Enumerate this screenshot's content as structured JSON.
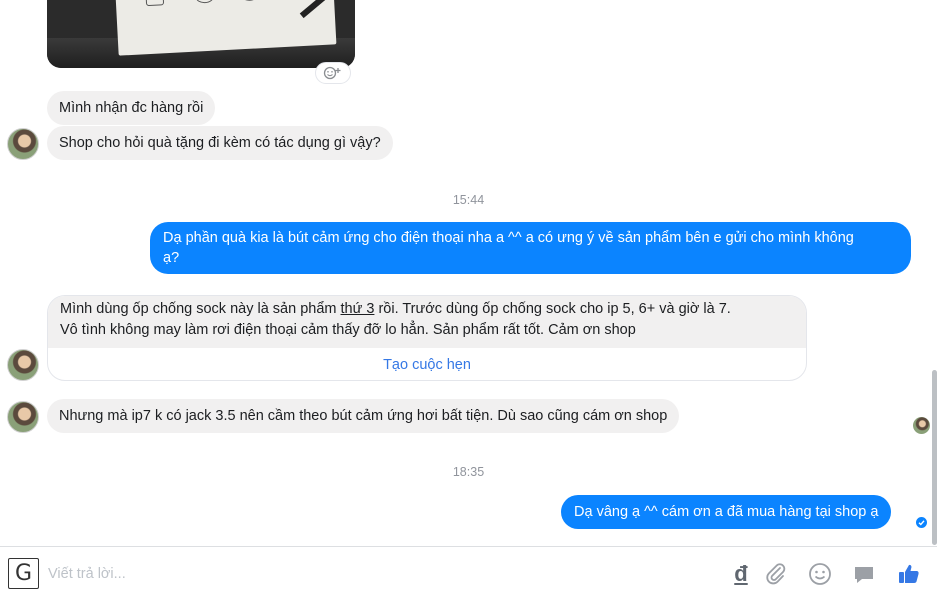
{
  "messages": {
    "m1": "Mình nhận đc hàng rồi",
    "m2": "Shop cho hỏi quà tặng đi kèm có tác dụng gì vậy?",
    "time1": "15:44",
    "m3_line1": "Dạ phần quà kia là bút cảm ứng cho điện thoại nha a ^^ a có ưng ý về sản phẩm bên e gửi cho mình không",
    "m3_line2": "ạ?",
    "m4_part1": "Mình dùng ốp chống sock này là sản phẩm ",
    "m4_link": "thứ 3",
    "m4_part2": " rồi. Trước dùng ốp chống sock cho ip 5, 6+ và giờ là 7.",
    "m4_line2": "Vô tình không may làm rơi điện thoại cảm thấy đỡ lo hẳn. Sản phẩm rất tốt. Cảm ơn shop",
    "m4_action": "Tạo cuộc hẹn",
    "m5": "Nhưng mà ip7 k có jack 3.5 nên cầm theo bút cảm ứng hơi bất tiện. Dù sao cũng cám ơn shop",
    "time2": "18:35",
    "m6": "Dạ vâng ạ ^^ cám ơn a đã mua hàng tại shop ạ"
  },
  "composer": {
    "placeholder": "Viết trả lời...",
    "currency_symbol": "đ"
  },
  "icons": {
    "add_reaction": "smiley-plus-icon",
    "currency": "dong-icon",
    "attach": "paperclip-icon",
    "emoji": "smiley-icon",
    "sticker": "chat-bubble-icon",
    "like": "thumbs-up-icon"
  },
  "colors": {
    "outgoing_bubble": "#0b84ff",
    "incoming_bubble": "#f1f0f0",
    "action_link": "#3578e5",
    "like_icon": "#3578e5"
  }
}
